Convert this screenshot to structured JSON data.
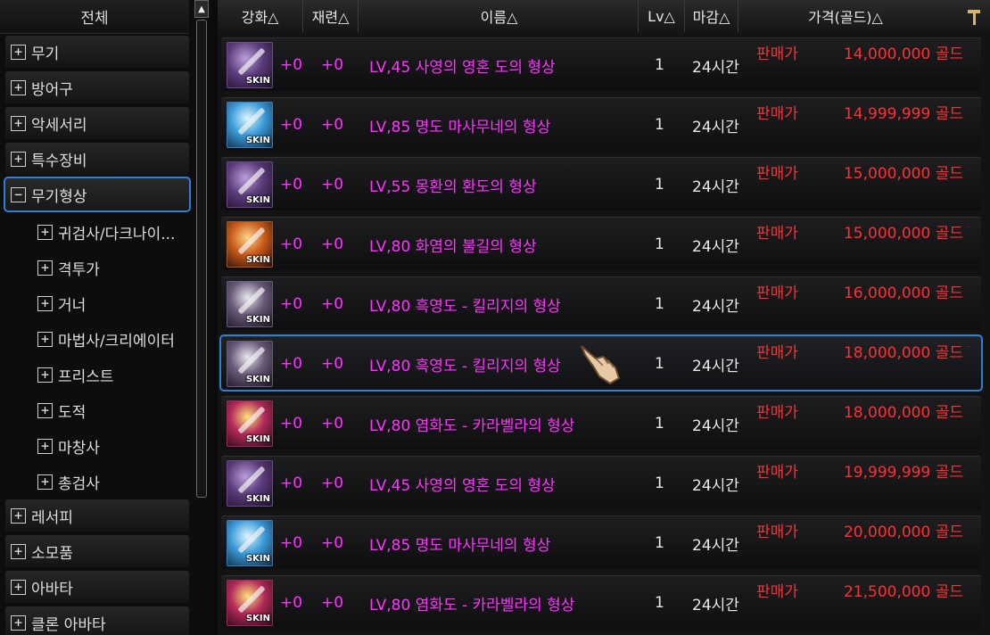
{
  "sidebar": {
    "header": "전체",
    "items": [
      {
        "label": "무기",
        "type": "cat",
        "expanded": false
      },
      {
        "label": "방어구",
        "type": "cat",
        "expanded": false
      },
      {
        "label": "악세서리",
        "type": "cat",
        "expanded": false
      },
      {
        "label": "특수장비",
        "type": "cat",
        "expanded": false
      },
      {
        "label": "무기형상",
        "type": "cat",
        "expanded": true,
        "selected": true
      },
      {
        "label": "귀검사/다크나이...",
        "type": "sub"
      },
      {
        "label": "격투가",
        "type": "sub"
      },
      {
        "label": "거너",
        "type": "sub"
      },
      {
        "label": "마법사/크리에이터",
        "type": "sub"
      },
      {
        "label": "프리스트",
        "type": "sub"
      },
      {
        "label": "도적",
        "type": "sub"
      },
      {
        "label": "마창사",
        "type": "sub"
      },
      {
        "label": "총검사",
        "type": "sub"
      },
      {
        "label": "레서피",
        "type": "cat",
        "expanded": false
      },
      {
        "label": "소모품",
        "type": "cat",
        "expanded": false
      },
      {
        "label": "아바타",
        "type": "cat",
        "expanded": false
      },
      {
        "label": "클론 아바타",
        "type": "cat",
        "expanded": false
      }
    ],
    "plus_symbol": "+",
    "minus_symbol": "−",
    "scroll_up_symbol": "▲"
  },
  "table": {
    "headers": {
      "enhance": "강화△",
      "refine": "재련△",
      "name": "이름△",
      "lv": "Lv△",
      "deadline": "마감△",
      "price": "가격(골드)△"
    },
    "tool_icon": "hammer-icon",
    "rows": [
      {
        "enh": "+0",
        "ref": "+0",
        "name": "LV,45 사영의 영혼 도의 형상",
        "lv": "1",
        "deadline": "24시간",
        "sale": "판매가",
        "price": "14,000,000 골드",
        "icon": "purple",
        "skin": "SKIN"
      },
      {
        "enh": "+0",
        "ref": "+0",
        "name": "LV,85 명도 마사무네의 형상",
        "lv": "1",
        "deadline": "24시간",
        "sale": "판매가",
        "price": "14,999,999 골드",
        "icon": "blue",
        "skin": "SKIN"
      },
      {
        "enh": "+0",
        "ref": "+0",
        "name": "LV,55 몽환의 환도의 형상",
        "lv": "1",
        "deadline": "24시간",
        "sale": "판매가",
        "price": "15,000,000 골드",
        "icon": "purple",
        "skin": "SKIN"
      },
      {
        "enh": "+0",
        "ref": "+0",
        "name": "LV,80 화염의 불길의 형상",
        "lv": "1",
        "deadline": "24시간",
        "sale": "판매가",
        "price": "15,000,000 골드",
        "icon": "orange",
        "skin": "SKIN"
      },
      {
        "enh": "+0",
        "ref": "+0",
        "name": "LV,80 흑영도 - 킬리지의 형상",
        "lv": "1",
        "deadline": "24시간",
        "sale": "판매가",
        "price": "16,000,000 골드",
        "icon": "gray",
        "skin": "SKIN"
      },
      {
        "enh": "+0",
        "ref": "+0",
        "name": "LV,80 흑영도 - 킬리지의 형상",
        "lv": "1",
        "deadline": "24시간",
        "sale": "판매가",
        "price": "18,000,000 골드",
        "icon": "gray",
        "skin": "SKIN",
        "selected": true
      },
      {
        "enh": "+0",
        "ref": "+0",
        "name": "LV,80 염화도 - 카라벨라의 형상",
        "lv": "1",
        "deadline": "24시간",
        "sale": "판매가",
        "price": "18,000,000 골드",
        "icon": "red",
        "skin": "SKIN"
      },
      {
        "enh": "+0",
        "ref": "+0",
        "name": "LV,45 사영의 영혼 도의 형상",
        "lv": "1",
        "deadline": "24시간",
        "sale": "판매가",
        "price": "19,999,999 골드",
        "icon": "purple",
        "skin": "SKIN"
      },
      {
        "enh": "+0",
        "ref": "+0",
        "name": "LV,85 명도 마사무네의 형상",
        "lv": "1",
        "deadline": "24시간",
        "sale": "판매가",
        "price": "20,000,000 골드",
        "icon": "blue",
        "skin": "SKIN"
      },
      {
        "enh": "+0",
        "ref": "+0",
        "name": "LV,80 염화도 - 카라벨라의 형상",
        "lv": "1",
        "deadline": "24시간",
        "sale": "판매가",
        "price": "21,500,000 골드",
        "icon": "red",
        "skin": "SKIN"
      }
    ]
  },
  "colors": {
    "item_name": "#ff33ff",
    "price": "#ff3030",
    "selection": "#2f7fd3"
  }
}
